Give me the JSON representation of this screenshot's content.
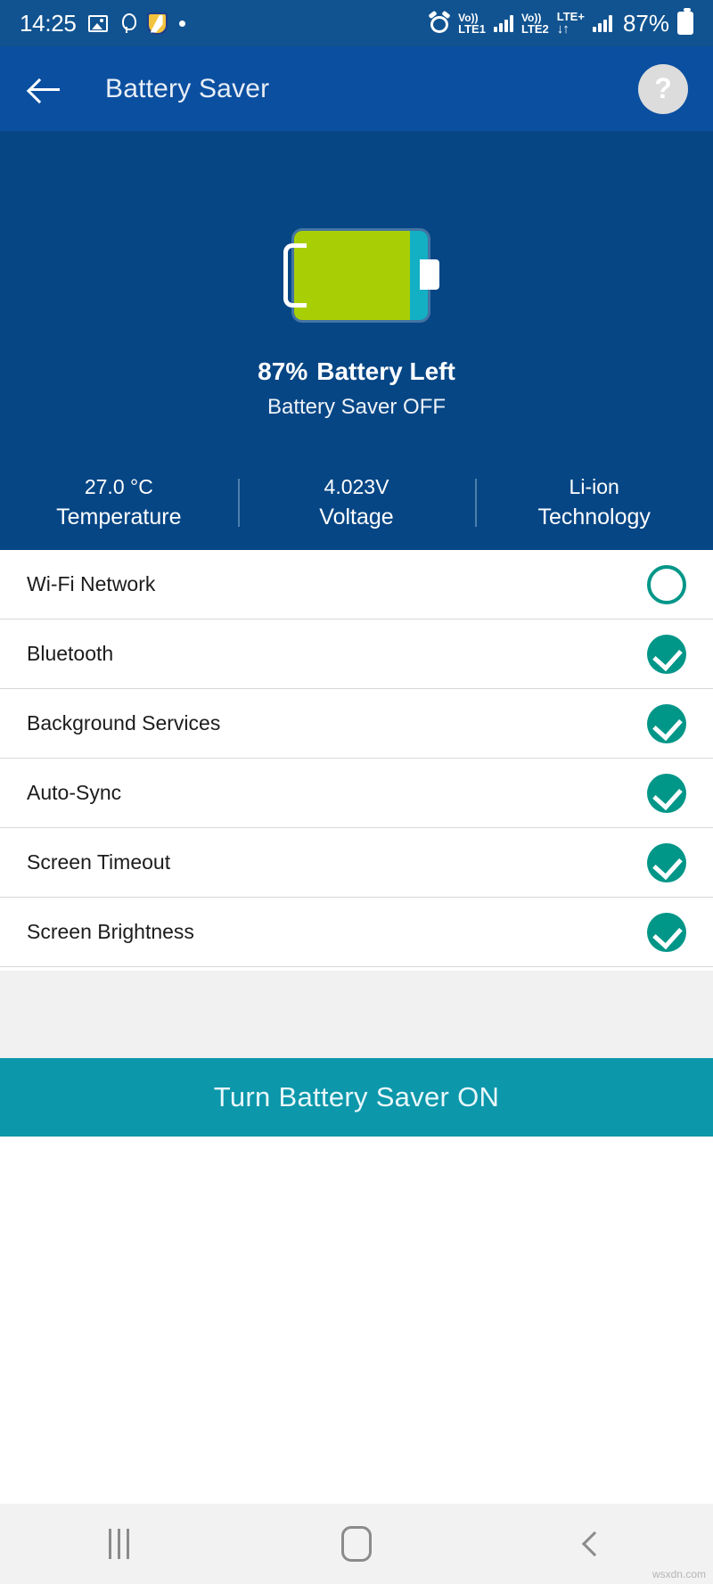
{
  "status_bar": {
    "time": "14:25",
    "left_icons": [
      "image-icon",
      "bird-icon",
      "shield-icon",
      "dot-icon"
    ],
    "alarm_icon": "alarm-icon",
    "sim1": {
      "volte": "Vo))",
      "network": "LTE1"
    },
    "sim2": {
      "volte": "Vo))",
      "network": "LTE2",
      "plus": "LTE+",
      "data_arrows": "↓↑"
    },
    "battery_percent": "87%"
  },
  "appbar": {
    "back_icon": "back-arrow-icon",
    "title": "Battery Saver",
    "help_label": "?"
  },
  "hero": {
    "battery_level": 87,
    "percent_label": "87%",
    "battery_left_label": "Battery Left",
    "saver_state_label": "Battery Saver OFF",
    "fill_color": "#a8cf06",
    "empty_color": "#13b0c4",
    "background_color": "#064685",
    "stats": [
      {
        "value": "27.0 °C",
        "label": "Temperature"
      },
      {
        "value": "4.023V",
        "label": "Voltage"
      },
      {
        "value": "Li-ion",
        "label": "Technology"
      }
    ]
  },
  "settings": {
    "accent_color": "#009688",
    "items": [
      {
        "label": "Wi-Fi Network",
        "checked": false
      },
      {
        "label": "Bluetooth",
        "checked": true
      },
      {
        "label": "Background Services",
        "checked": true
      },
      {
        "label": "Auto-Sync",
        "checked": true
      },
      {
        "label": "Screen Timeout",
        "checked": true
      },
      {
        "label": "Screen Brightness",
        "checked": true
      }
    ]
  },
  "cta": {
    "label": "Turn Battery Saver ON",
    "color": "#0c97ab"
  },
  "navbar": {
    "recents_icon": "recents-icon",
    "home_icon": "home-icon",
    "back_icon": "back-icon"
  },
  "watermark": "wsxdn.com"
}
